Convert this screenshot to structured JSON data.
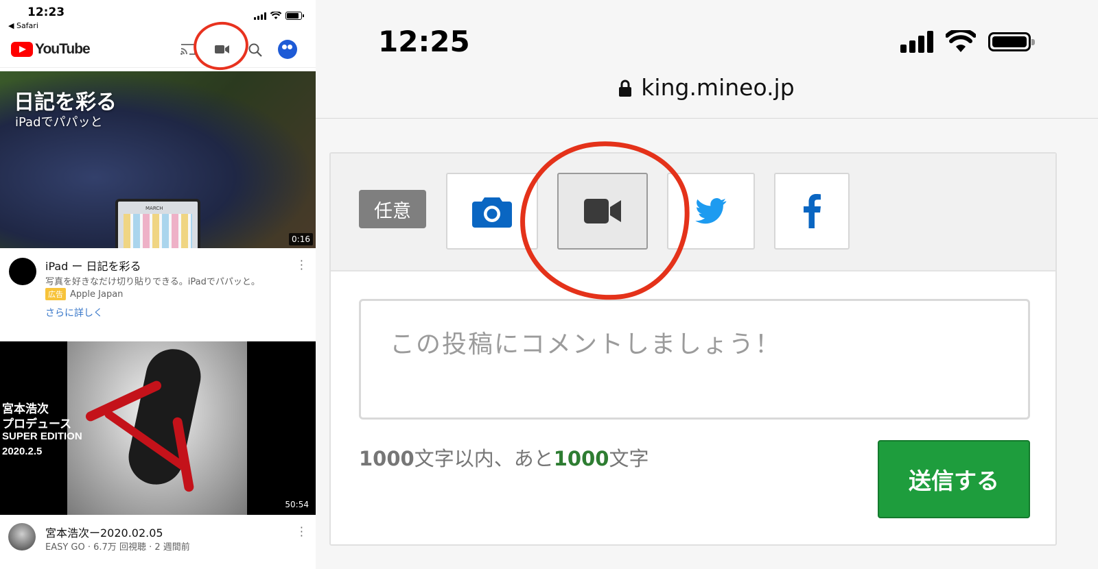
{
  "left_app": {
    "status": {
      "time": "12:23",
      "back_label": "◀ Safari"
    },
    "header": {
      "logo_text": "YouTube",
      "icons": [
        "cast-icon",
        "video-camera-icon",
        "search-icon",
        "account-avatar-icon"
      ]
    },
    "ad": {
      "thumbnail_title": "日記を彩る",
      "thumbnail_subtitle": "iPadでパパッと",
      "thumbnail_screen_label": "MARCH",
      "duration": "0:16",
      "title": "iPad ー 日記を彩る",
      "description": "写真を好きなだけ切り貼りできる。iPadでパパッと。",
      "badge": "広告",
      "channel": "Apple Japan",
      "link": "さらに詳しく"
    },
    "video": {
      "thumbnail_lines": [
        "宮本浩次",
        "プロデュース",
        "SUPER EDITION",
        "2020.2.5"
      ],
      "duration": "50:54",
      "title": "宮本浩次ー2020.02.05",
      "meta": "EASY GO · 6.7万 回視聴 · 2 週間前"
    }
  },
  "right_app": {
    "status": {
      "time": "12:25"
    },
    "url": "king.mineo.jp",
    "form": {
      "optional_badge": "任意",
      "attach_buttons": [
        "camera-icon",
        "video-camera-icon",
        "twitter-icon",
        "facebook-icon"
      ],
      "active_button": "video-camera-icon",
      "comment_placeholder": "この投稿にコメントしましょう！",
      "counter_max": "1000",
      "counter_text_1": "文字以内、あと",
      "counter_remaining": "1000",
      "counter_text_2": "文字",
      "submit_label": "送信する"
    }
  },
  "colors": {
    "youtube_red": "#ff0000",
    "annotation_red": "#e4321a",
    "submit_green": "#1e9d3d",
    "icon_blue": "#0a66c2",
    "twitter_blue": "#1d9bf0"
  }
}
